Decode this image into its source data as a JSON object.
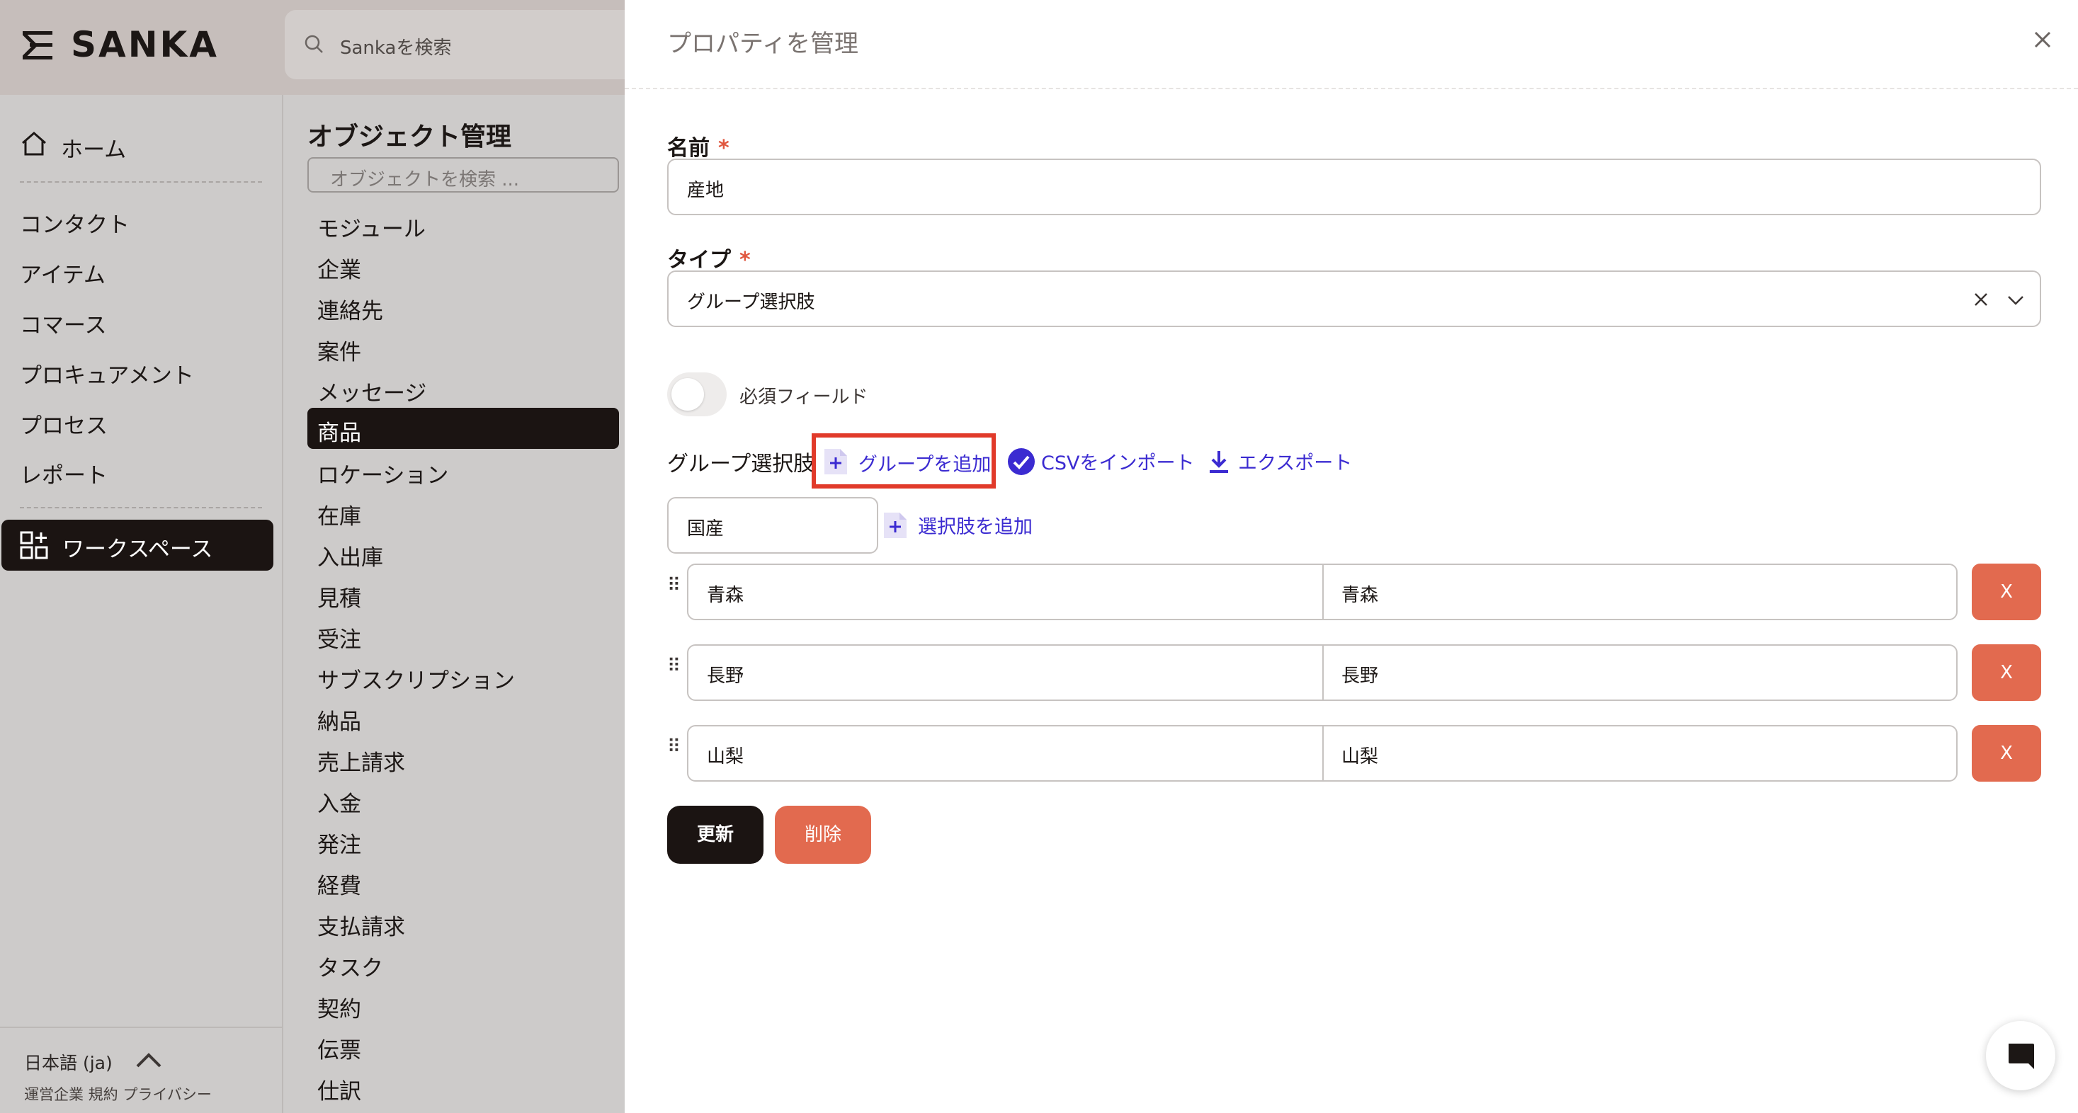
{
  "app": {
    "brand": "SANKA",
    "search_placeholder": "Sankaを検索"
  },
  "sidebar": {
    "home": "ホーム",
    "items": [
      "コンタクト",
      "アイテム",
      "コマース",
      "プロキュアメント",
      "プロセス",
      "レポート"
    ],
    "workspace": "ワークスペース",
    "language": "日本語 (ja)",
    "footer_links": "運営企業 規約 プライバシー"
  },
  "objects": {
    "title": "オブジェクト管理",
    "search_placeholder": "オブジェクトを検索 ...",
    "items": [
      "モジュール",
      "企業",
      "連絡先",
      "案件",
      "メッセージ",
      "商品",
      "ロケーション",
      "在庫",
      "入出庫",
      "見積",
      "受注",
      "サブスクリプション",
      "納品",
      "売上請求",
      "入金",
      "発注",
      "経費",
      "支払請求",
      "タスク",
      "契約",
      "伝票",
      "仕訳"
    ],
    "active": "商品"
  },
  "drawer": {
    "title": "プロパティを管理",
    "name_label": "名前",
    "name_value": "産地",
    "type_label": "タイプ",
    "type_value": "グループ選択肢",
    "required_marker": "*",
    "required_toggle_label": "必須フィールド",
    "required_toggle_on": false,
    "group_section_label": "グループ選択肢",
    "add_group": "グループを追加",
    "csv_import": "CSVをインポート",
    "export": "エクスポート",
    "group_name": "国産",
    "add_option": "選択肢を追加",
    "options": [
      {
        "label": "青森",
        "value": "青森"
      },
      {
        "label": "長野",
        "value": "長野"
      },
      {
        "label": "山梨",
        "value": "山梨"
      }
    ],
    "remove_label": "X",
    "update_button": "更新",
    "delete_button": "削除"
  },
  "colors": {
    "accent_dark": "#1b1412",
    "danger": "#e26a4f",
    "link": "#3b2bd1",
    "highlight": "#e13a2a"
  }
}
